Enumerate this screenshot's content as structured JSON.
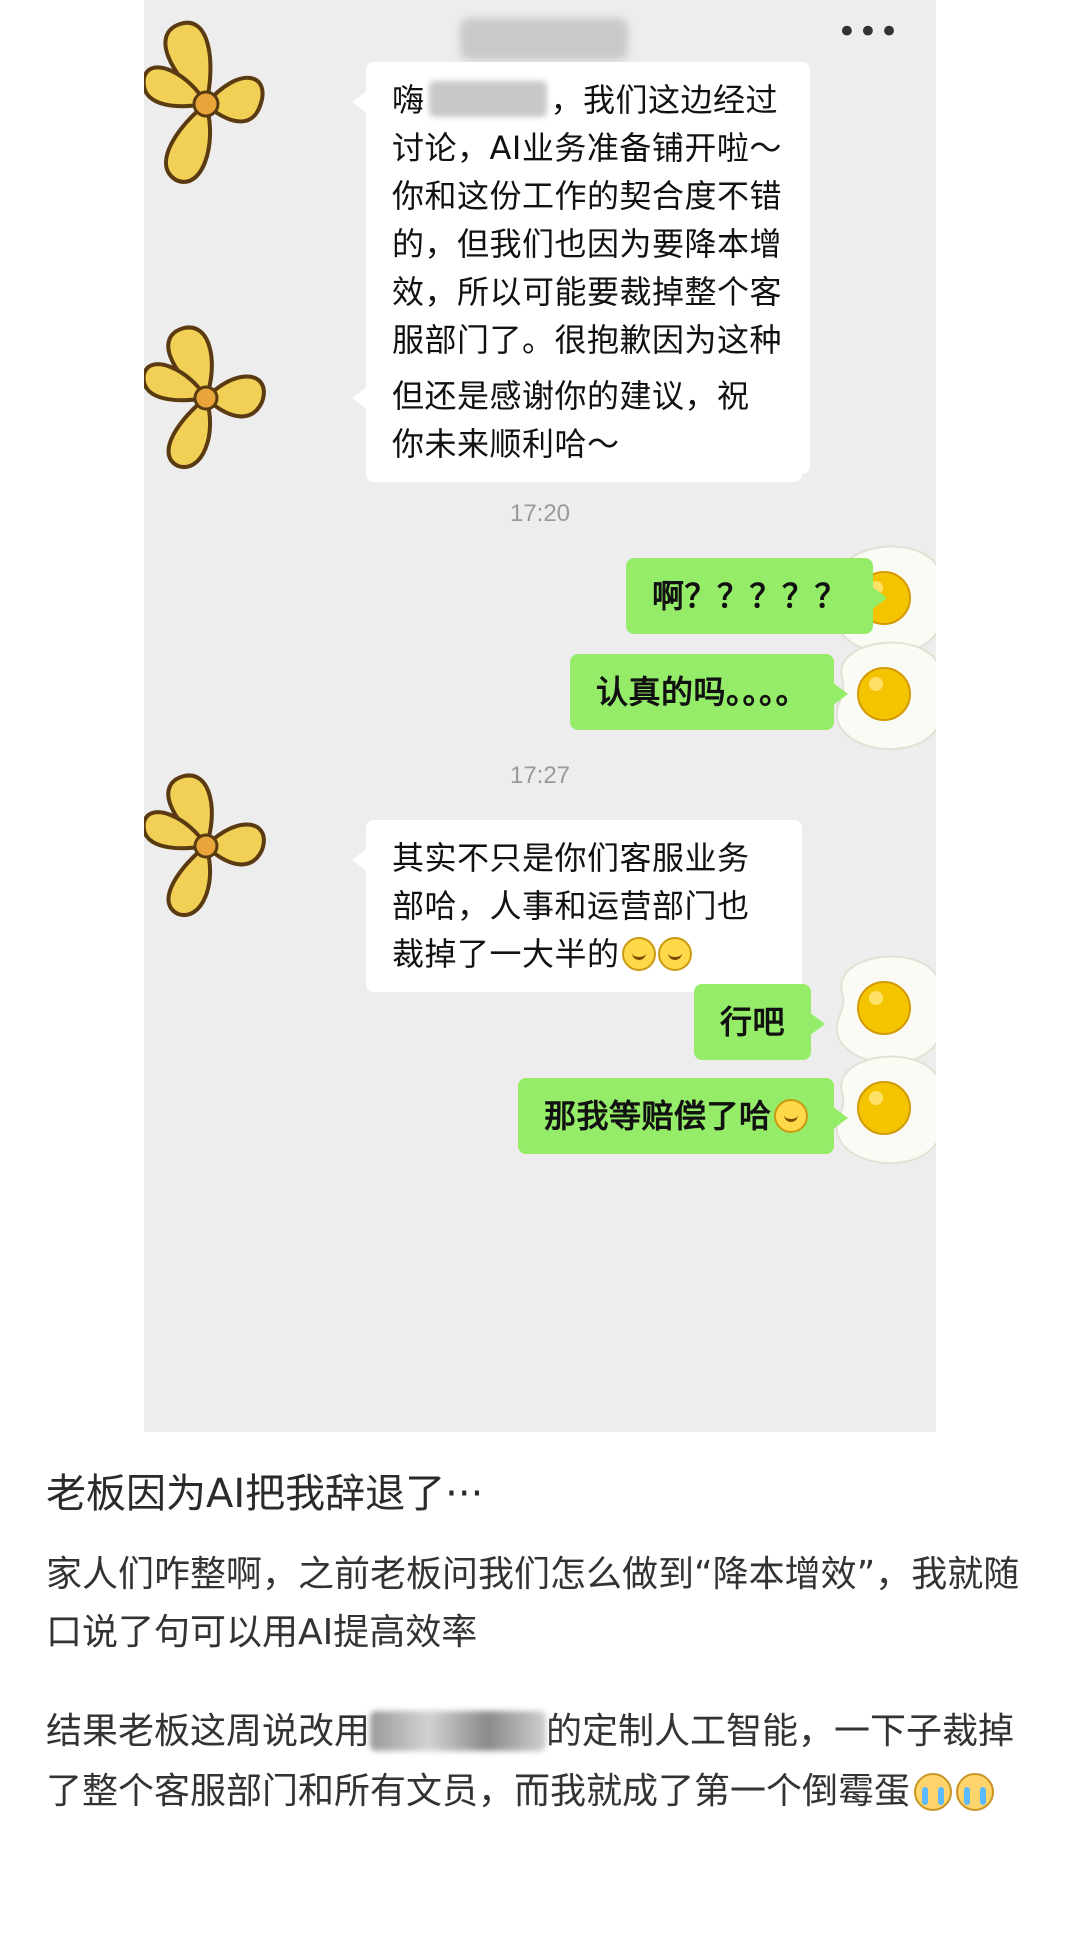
{
  "header": {
    "more_icon": "more-horizontal-icon"
  },
  "messages": {
    "m1": {
      "part1": "嗨",
      "part2": "，我们这边经过讨论，AI业务准备铺开啦～ 你和这份工作的契合度不错的，但我们也因为要降本增效，所以可能要裁掉整个客服部门了。很抱歉因为这种原因让你离职，相关的赔偿都会给到你的！"
    },
    "m2": "但还是感谢你的建议，祝你未来顺利哈～",
    "t1": "17:20",
    "m3": "啊？？？？？",
    "m4": "认真的吗。。。。",
    "t2": "17:27",
    "m5": "其实不只是你们客服业务部哈，人事和运营部门也裁掉了一大半的",
    "m6": "行吧",
    "m7": "那我等赔偿了哈"
  },
  "post": {
    "title": "老板因为AI把我辞退了···",
    "p1": "家人们咋整啊，之前老板问我们怎么做到“降本增效”，我就随口说了句可以用AI提高效率",
    "p2_before": "结果老板这周说改用",
    "p2_after": "的定制人工智能，一下子裁掉了整个客服部门和所有文员，而我就成了第一个倒霉蛋"
  },
  "colors": {
    "chat_bg": "#ededed",
    "bubble_self": "#95ec69",
    "bubble_other": "#ffffff",
    "time_text": "#9a9a9a"
  }
}
